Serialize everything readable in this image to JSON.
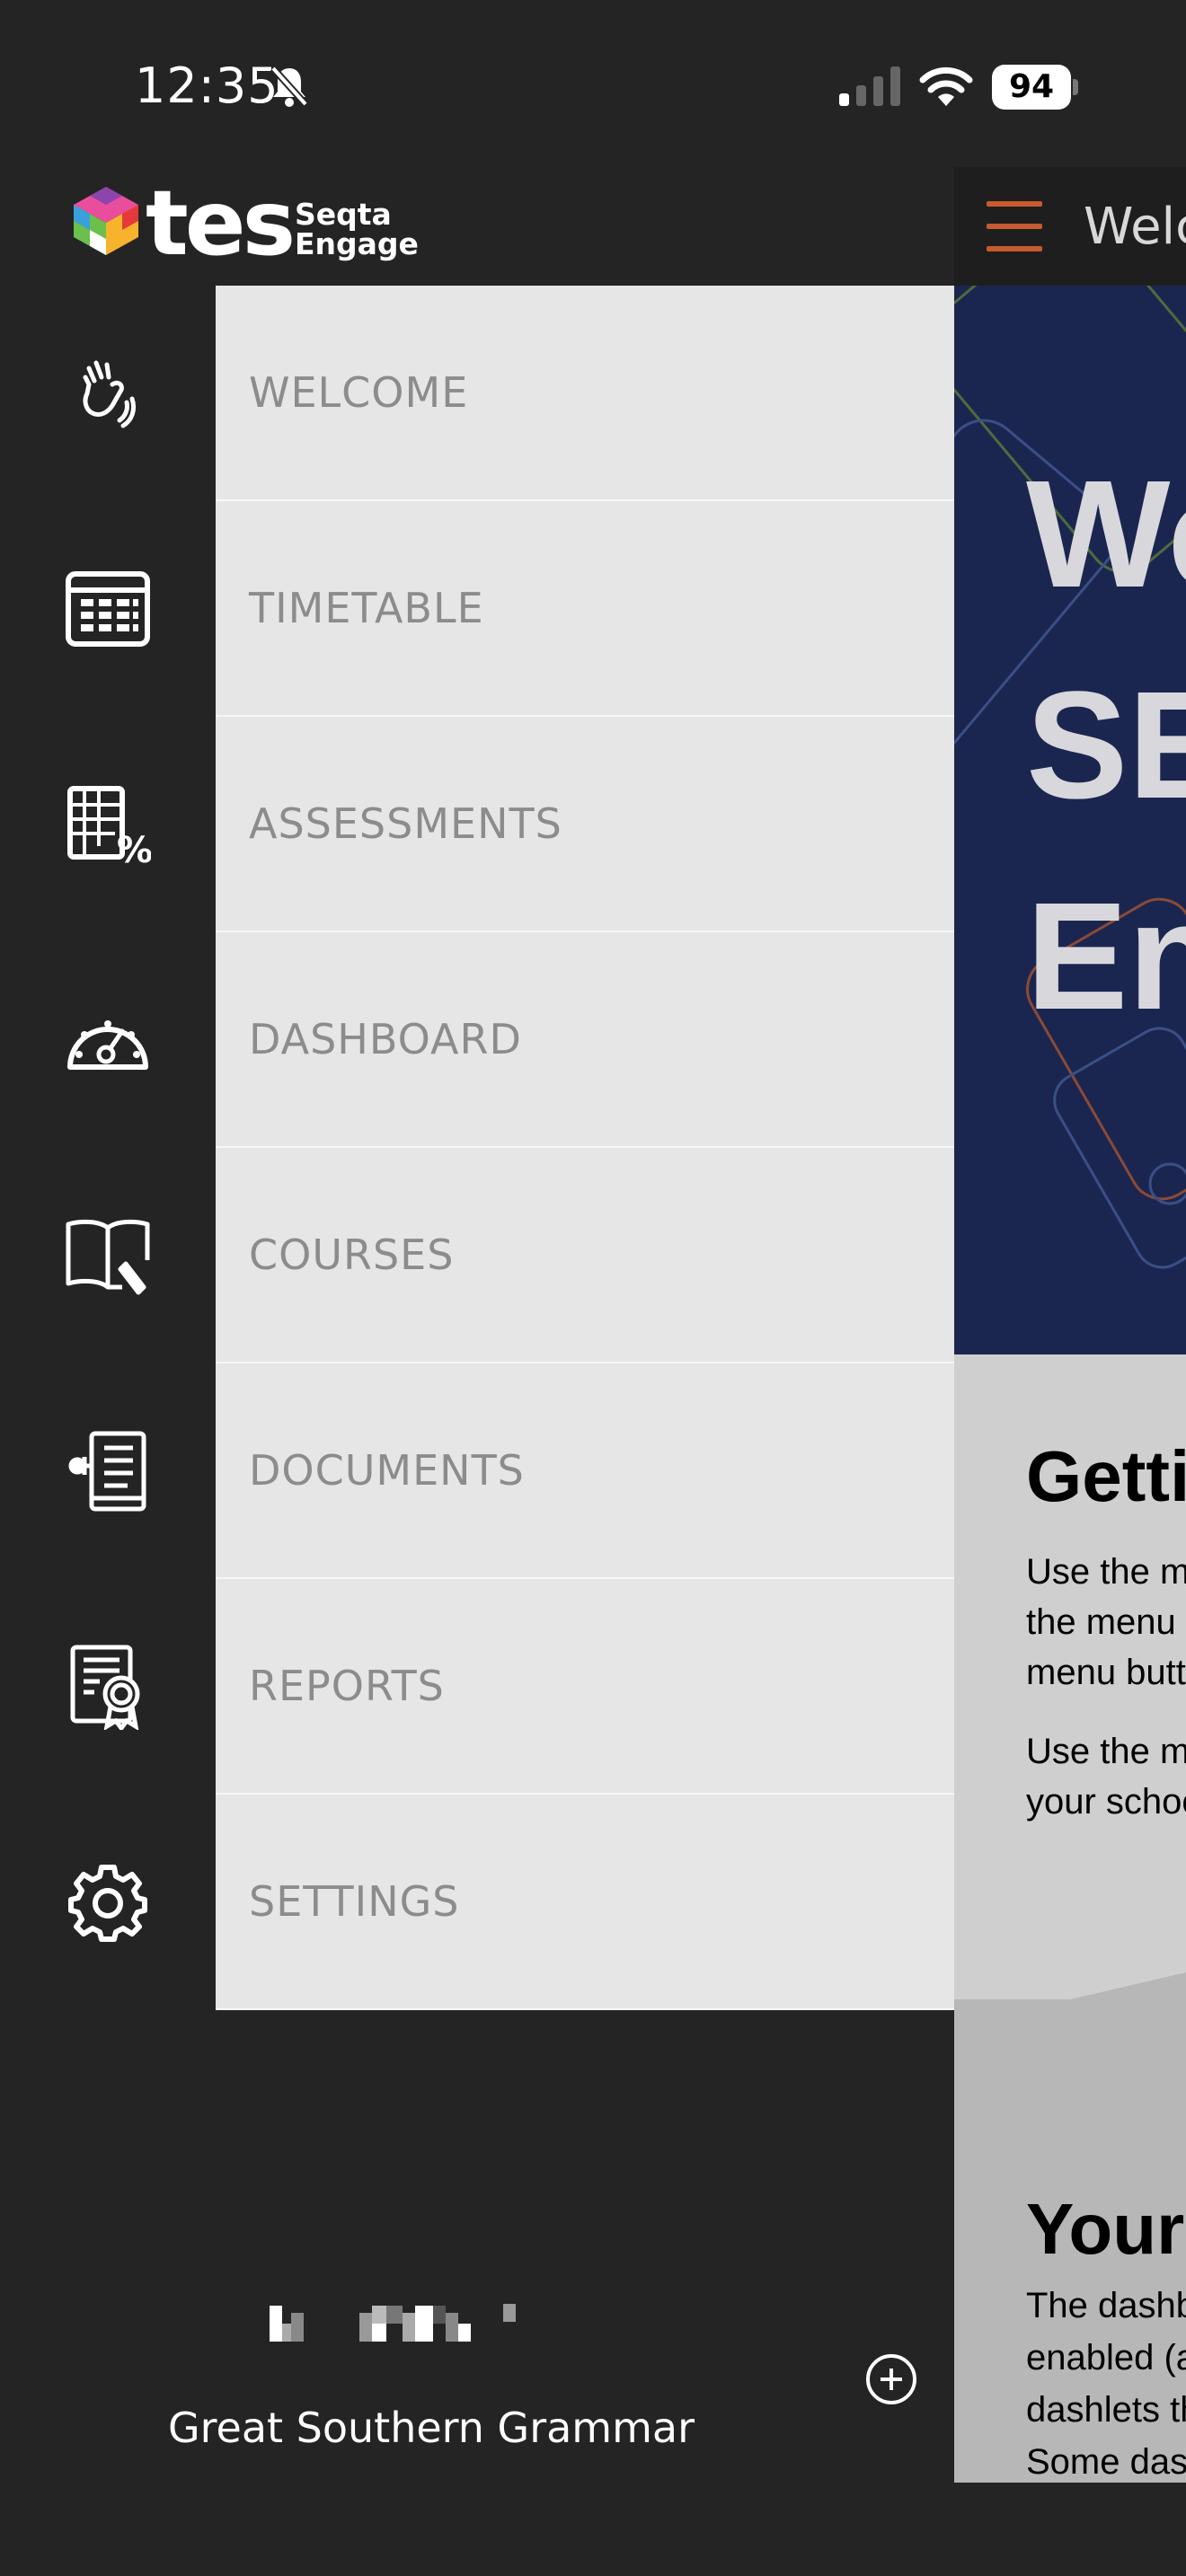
{
  "status_bar": {
    "time": "12:35",
    "battery": "94"
  },
  "brand": {
    "logo_text": "tes",
    "product_line1": "Seqta",
    "product_line2": "Engage"
  },
  "sidebar": {
    "items": [
      {
        "label": "WELCOME",
        "icon": "hand-wave-icon"
      },
      {
        "label": "TIMETABLE",
        "icon": "timetable-icon"
      },
      {
        "label": "ASSESSMENTS",
        "icon": "assessments-icon"
      },
      {
        "label": "DASHBOARD",
        "icon": "dashboard-gauge-icon"
      },
      {
        "label": "COURSES",
        "icon": "courses-book-icon"
      },
      {
        "label": "DOCUMENTS",
        "icon": "documents-icon"
      },
      {
        "label": "REPORTS",
        "icon": "reports-certificate-icon"
      },
      {
        "label": "SETTINGS",
        "icon": "settings-gear-icon"
      }
    ],
    "school_name": "Great Southern Grammar"
  },
  "main": {
    "topbar_title": "Welc",
    "hero_lines": [
      "We",
      "SE",
      "En"
    ],
    "section1": {
      "heading": "Getti",
      "para1_lines": [
        "Use the m",
        "the menu",
        "menu butt"
      ],
      "para2_lines": [
        "Use the m",
        "your schoo"
      ]
    },
    "section2": {
      "heading": "Your",
      "para_lines": [
        "The dashb",
        "enabled (a",
        "dashlets th",
        "Some das"
      ]
    }
  },
  "colors": {
    "background": "#242425",
    "menu_panel": "#e6e6e6",
    "hero": "#1b2650",
    "accent": "#c85a2f"
  }
}
